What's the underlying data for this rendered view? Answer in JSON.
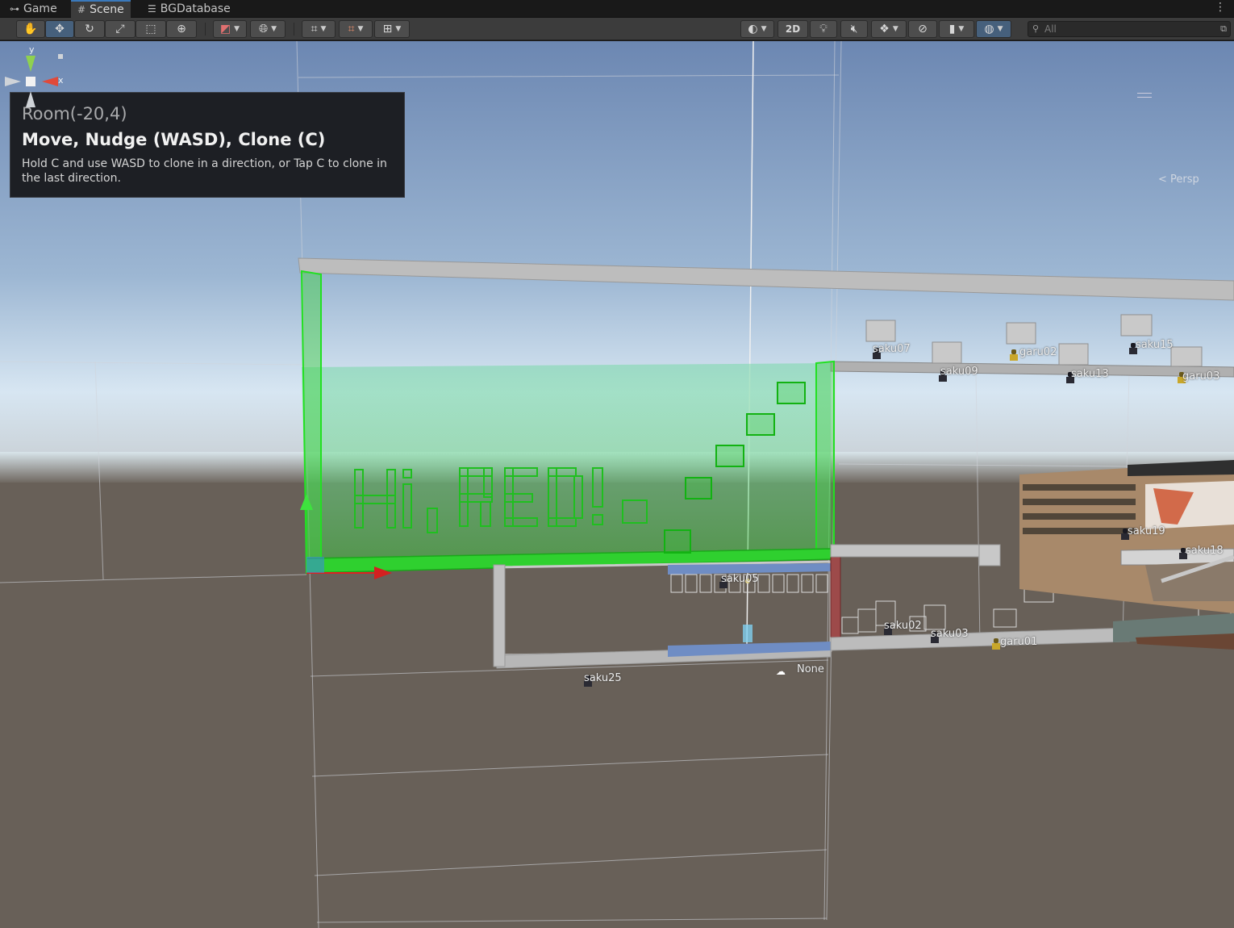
{
  "tabs": [
    {
      "icon": "gamepad-icon",
      "glyph": "⊶",
      "label": "Game"
    },
    {
      "icon": "scene-grid-icon",
      "glyph": "#",
      "label": "Scene"
    },
    {
      "icon": "database-icon",
      "glyph": "☰",
      "label": "BGDatabase"
    }
  ],
  "toolbar": {
    "view2d_label": "2D",
    "search_placeholder": "All"
  },
  "overlay": {
    "room": "Room(-20,4)",
    "mode": "Move, Nudge (WASD), Clone (C)",
    "hint": "Hold C and use WASD to clone in a direction, or Tap C to clone in the last direction."
  },
  "gizmo": {
    "y_label": "y",
    "x_label": "x",
    "persp_label": "Persp"
  },
  "scene": {
    "pixel_text": "Hi, RED!",
    "entities": [
      {
        "name": "saku07",
        "label": "saku07"
      },
      {
        "name": "garu02",
        "label": "garu02"
      },
      {
        "name": "saku15",
        "label": "saku15"
      },
      {
        "name": "saku09",
        "label": "saku09"
      },
      {
        "name": "saku13",
        "label": "saku13"
      },
      {
        "name": "garu03",
        "label": "garu03"
      },
      {
        "name": "saku19",
        "label": "saku19"
      },
      {
        "name": "saku18",
        "label": "saku18"
      },
      {
        "name": "saku05",
        "label": "saku05"
      },
      {
        "name": "saku02",
        "label": "saku02"
      },
      {
        "name": "saku03",
        "label": "saku03"
      },
      {
        "name": "garu01",
        "label": "garu01"
      },
      {
        "name": "saku25",
        "label": "saku25"
      },
      {
        "name": "none",
        "label": "None"
      }
    ]
  },
  "colors": {
    "accent": "#3a79bb",
    "selection_green": "#22e022",
    "sky_top": "#6f8bb6",
    "ground": "#686058"
  }
}
